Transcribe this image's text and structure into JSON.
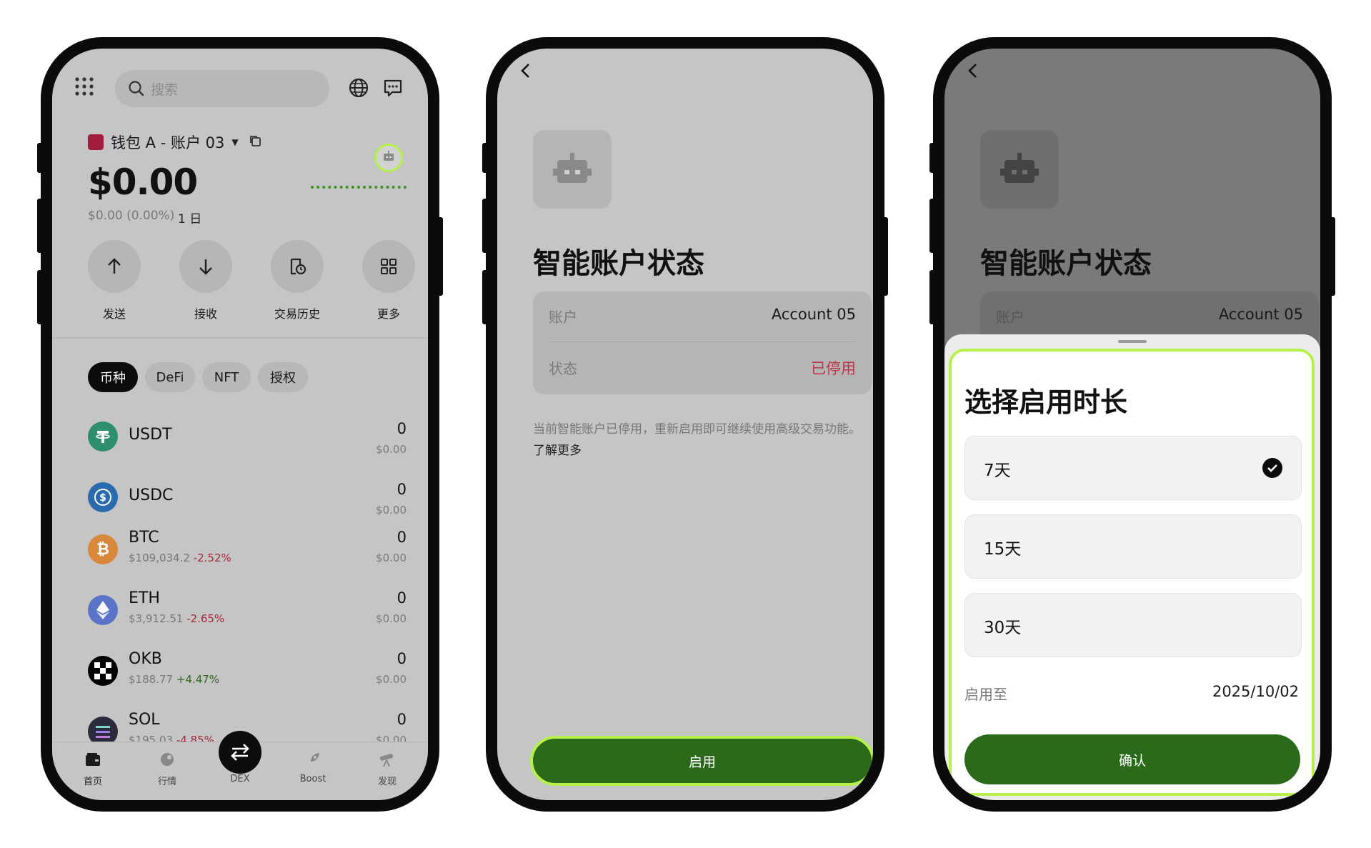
{
  "screen1": {
    "search_placeholder": "搜索",
    "wallet_name": "钱包 A - 账户 03",
    "balance": "$0.00",
    "change": "$0.00 (0.00%)",
    "period": "1 日",
    "actions": [
      {
        "label": "发送",
        "icon": "arrow-up-icon"
      },
      {
        "label": "接收",
        "icon": "arrow-down-icon"
      },
      {
        "label": "交易历史",
        "icon": "history-icon"
      },
      {
        "label": "更多",
        "icon": "grid-icon"
      }
    ],
    "tabs": [
      "币种",
      "DeFi",
      "NFT",
      "授权"
    ],
    "coins": [
      {
        "name": "USDT",
        "price": "",
        "change": "",
        "amount": "0",
        "value": "$0.00",
        "color": "#26a17b"
      },
      {
        "name": "USDC",
        "price": "",
        "change": "",
        "amount": "0",
        "value": "$0.00",
        "color": "#2775ca"
      },
      {
        "name": "BTC",
        "price": "$109,034.2",
        "change": "-2.52%",
        "amount": "0",
        "value": "$0.00",
        "color": "#f7931a"
      },
      {
        "name": "ETH",
        "price": "$3,912.51",
        "change": "-2.65%",
        "amount": "0",
        "value": "$0.00",
        "color": "#627eea"
      },
      {
        "name": "OKB",
        "price": "$188.77",
        "change": "+4.47%",
        "amount": "0",
        "value": "$0.00",
        "color": "#000000"
      },
      {
        "name": "SOL",
        "price": "$195.03",
        "change": "-4.85%",
        "amount": "0",
        "value": "$0.00",
        "color": "#2b2b4a"
      }
    ],
    "nav": [
      {
        "label": "首页",
        "icon": "wallet-icon"
      },
      {
        "label": "行情",
        "icon": "market-icon"
      },
      {
        "label": "DEX",
        "icon": "swap-icon"
      },
      {
        "label": "Boost",
        "icon": "rocket-icon"
      },
      {
        "label": "发现",
        "icon": "telescope-icon"
      }
    ]
  },
  "screen2": {
    "title": "智能账户状态",
    "account_label": "账户",
    "account_value": "Account 05",
    "status_label": "状态",
    "status_value": "已停用",
    "description": "当前智能账户已停用，重新启用即可继续使用高级交易功能。",
    "learn_more": "了解更多",
    "enable_button": "启用"
  },
  "screen3": {
    "title": "智能账户状态",
    "account_label": "账户",
    "account_value": "Account 05",
    "sheet_title": "选择启用时长",
    "options": [
      "7天",
      "15天",
      "30天"
    ],
    "selected_option": "7天",
    "enable_until_label": "启用至",
    "enable_until_value": "2025/10/02",
    "confirm_button": "确认"
  },
  "colors": {
    "accent_green": "#2a6a1a",
    "highlight": "#b7f04a",
    "disabled_red": "#c0344c"
  }
}
